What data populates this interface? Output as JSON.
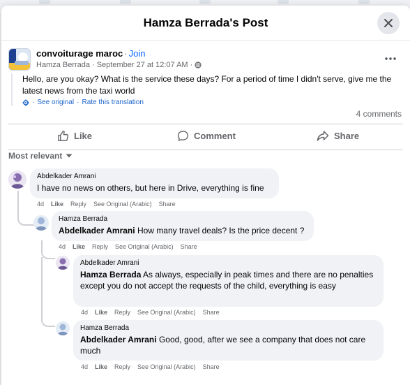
{
  "dialog": {
    "title": "Hamza Berrada's Post"
  },
  "post": {
    "page_name": "convoiturage maroc",
    "join_label": "Join",
    "author": "Hamza Berrada",
    "timestamp": "September 27 at 12:07 AM",
    "text": "Hello, are you okay? What is the service these days? For a period of time I didn't serve, give me the latest news from the taxi world",
    "see_original": "See original",
    "rate_translation": "Rate this translation",
    "comment_count": "4 comments"
  },
  "actions": {
    "like": "Like",
    "comment": "Comment",
    "share": "Share"
  },
  "sort_label": "Most relevant",
  "comments": [
    {
      "author": "Abdelkader Amrani",
      "mention": "",
      "text": "I have no news on others, but here in Drive, everything is fine",
      "age": "4d",
      "like": "Like",
      "reply": "Reply",
      "see_original": "See Original (Arabic)",
      "share": "Share"
    },
    {
      "author": "Hamza Berrada",
      "mention": "Abdelkader Amrani",
      "text": "How many travel deals? Is the price decent ?",
      "age": "4d",
      "like": "Like",
      "reply": "Reply",
      "see_original": "See Original (Arabic)",
      "share": "Share"
    },
    {
      "author": "Abdelkader Amrani",
      "mention": "Hamza Berrada",
      "text": "As always, especially in peak times and there are no penalties except you do not accept the requests of the child, everything is easy",
      "age": "4d",
      "like": "Like",
      "reply": "Reply",
      "see_original": "See Original (Arabic)",
      "share": "Share"
    },
    {
      "author": "Hamza Berrada",
      "mention": "Abdelkader Amrani",
      "text": "Good, good, after we see a company that does not care much",
      "age": "4d",
      "like": "Like",
      "reply": "Reply",
      "see_original": "See Original (Arabic)",
      "share": "Share"
    }
  ],
  "icons": {
    "close": "close-icon",
    "more": "more-options-icon",
    "globe": "globe-icon",
    "like": "like-thumb-icon",
    "comment": "comment-bubble-icon",
    "share": "share-arrow-icon",
    "translate": "translate-gear-icon",
    "chevron": "chevron-down-icon"
  },
  "colors": {
    "link": "#0866ff",
    "muted": "#65676b",
    "bubble": "#f0f2f5",
    "divider": "#ced0d4"
  }
}
